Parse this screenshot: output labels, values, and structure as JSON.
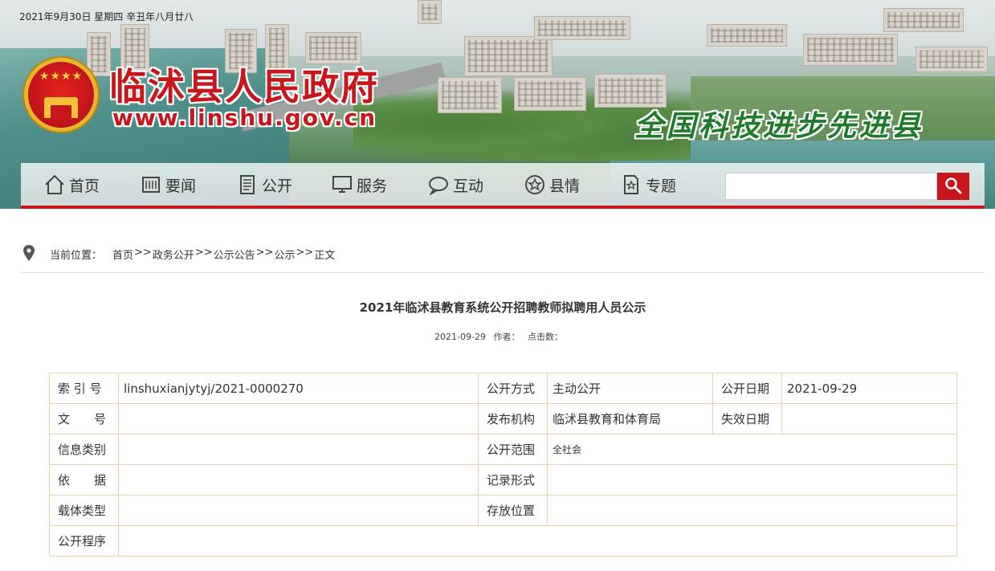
{
  "header": {
    "date_line": "2021年9月30日  星期四  辛丑年八月廿八",
    "site_title": "临沭县人民政府",
    "site_url": "www.linshu.gov.cn",
    "slogan": "全国科技进步先进县"
  },
  "nav": {
    "items": [
      {
        "label": "首页",
        "icon": "home-icon"
      },
      {
        "label": "要闻",
        "icon": "newspaper-icon"
      },
      {
        "label": "公开",
        "icon": "document-icon"
      },
      {
        "label": "服务",
        "icon": "computer-icon"
      },
      {
        "label": "互动",
        "icon": "chat-icon"
      },
      {
        "label": "县情",
        "icon": "star-icon"
      },
      {
        "label": "专题",
        "icon": "bookmark-star-icon"
      }
    ],
    "search_placeholder": "",
    "search_icon": "search-icon",
    "accent_color": "#c8161d"
  },
  "breadcrumb": {
    "label": "当前位置：",
    "items": [
      "首页",
      "政务公开",
      "公示公告",
      "公示",
      "正文"
    ],
    "separator": ">>"
  },
  "article": {
    "title": "2021年临沭县教育系统公开招聘教师拟聘用人员公示",
    "date": "2021-09-29",
    "author_label": "作者：",
    "clicks_label": "点击数："
  },
  "info_table": {
    "rows": [
      [
        "索 引 号",
        "linshuxianjytyj/2021-0000270",
        "公开方式",
        "主动公开",
        "公开日期",
        "2021-09-29"
      ],
      [
        "文　　号",
        "",
        "发布机构",
        "临沭县教育和体育局",
        "失效日期",
        ""
      ],
      [
        "信息类别",
        "",
        "公开范围",
        "全社会"
      ],
      [
        "依　　据",
        "",
        "记录形式",
        ""
      ],
      [
        "载体类型",
        "",
        "存放位置",
        ""
      ],
      [
        "公开程序",
        ""
      ]
    ]
  }
}
